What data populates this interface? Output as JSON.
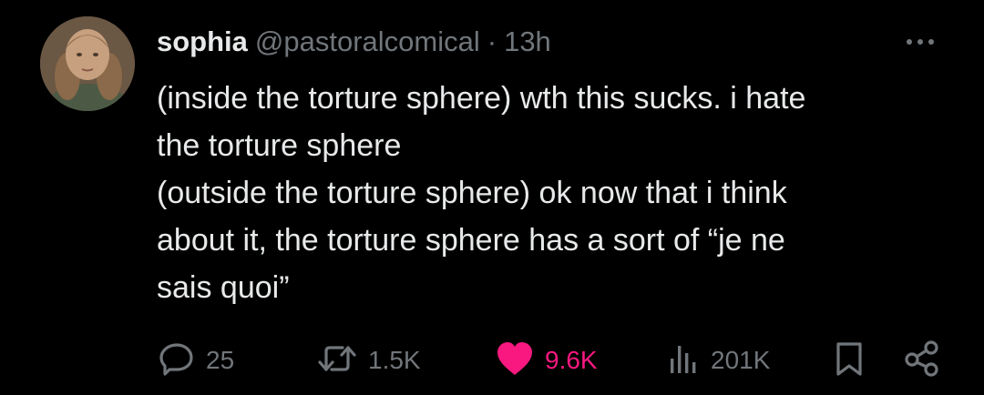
{
  "author": {
    "display_name": "sophia",
    "handle": "@pastoralcomical",
    "separator": "·",
    "time": "13h"
  },
  "tweet": {
    "lines": [
      "(inside the torture sphere) wth this sucks. i hate",
      "the torture sphere",
      "(outside the torture sphere) ok now that i think",
      "about it, the torture sphere has a sort of “je ne",
      "sais quoi”"
    ]
  },
  "actions": {
    "reply": {
      "icon": "reply-icon",
      "count": "25"
    },
    "retweet": {
      "icon": "retweet-icon",
      "count": "1.5K"
    },
    "like": {
      "icon": "heart-icon",
      "count": "9.6K",
      "liked": true
    },
    "views": {
      "icon": "views-icon",
      "count": "201K"
    },
    "bookmark": {
      "icon": "bookmark-icon"
    },
    "share": {
      "icon": "share-icon"
    }
  },
  "colors": {
    "background": "#000000",
    "primary_text": "#e7e9ea",
    "secondary_text": "#71767b",
    "like_pink": "#f91880"
  }
}
